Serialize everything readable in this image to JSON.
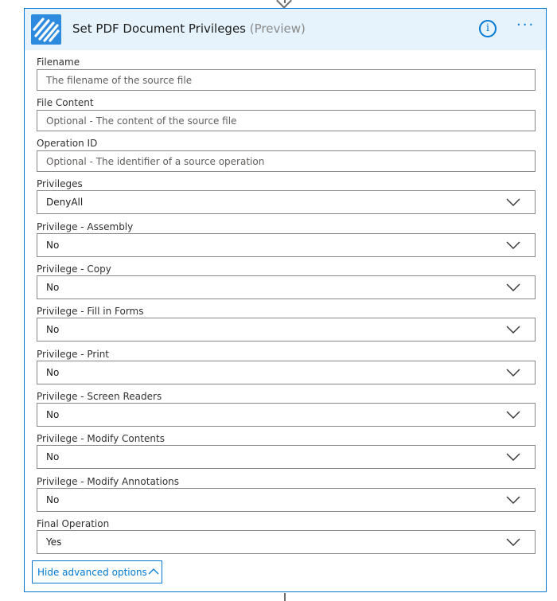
{
  "card": {
    "title": "Set PDF Document Privileges",
    "preview": "(Preview)",
    "info_glyph": "i",
    "more_glyph": "···",
    "accent_color": "#0078d4",
    "header_color": "#e6f2fc",
    "logo_color": "#2d8bdf"
  },
  "fields": {
    "filename": {
      "label": "Filename",
      "placeholder": "The filename of the source file"
    },
    "file_content": {
      "label": "File Content",
      "placeholder": "Optional - The content of the source file"
    },
    "operation_id": {
      "label": "Operation ID",
      "placeholder": "Optional - The identifier of a source operation"
    },
    "privileges": {
      "label": "Privileges",
      "value": "DenyAll"
    },
    "privilege_assembly": {
      "label": "Privilege - Assembly",
      "value": "No"
    },
    "privilege_copy": {
      "label": "Privilege - Copy",
      "value": "No"
    },
    "privilege_fill_forms": {
      "label": "Privilege - Fill in Forms",
      "value": "No"
    },
    "privilege_print": {
      "label": "Privilege - Print",
      "value": "No"
    },
    "privilege_screen_readers": {
      "label": "Privilege - Screen Readers",
      "value": "No"
    },
    "privilege_modify_contents": {
      "label": "Privilege - Modify Contents",
      "value": "No"
    },
    "privilege_modify_annotations": {
      "label": "Privilege - Modify Annotations",
      "value": "No"
    },
    "final_operation": {
      "label": "Final Operation",
      "value": "Yes"
    }
  },
  "advanced": {
    "toggle_label": "Hide advanced options"
  },
  "icons": {
    "logo": "stripes-logo-icon",
    "info": "info-icon",
    "more": "more-options-icon",
    "dropdown": "chevron-down-icon",
    "collapse": "chevron-up-icon"
  }
}
